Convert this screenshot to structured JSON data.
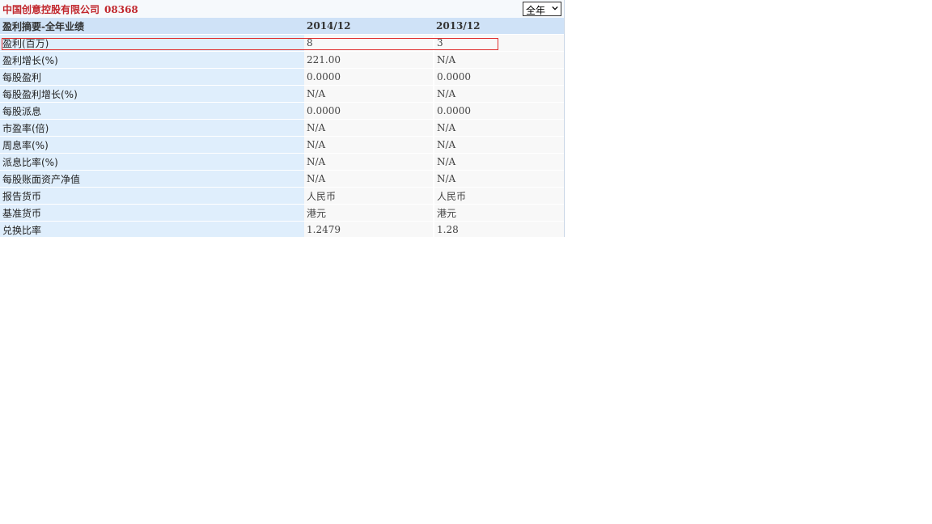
{
  "header": {
    "company_name": "中国创意控股有限公司",
    "stock_code": "08368",
    "period_select": {
      "value": "全年"
    }
  },
  "table": {
    "title": "盈利摘要-全年业绩",
    "columns": [
      "2014/12",
      "2013/12"
    ],
    "rows": [
      {
        "label": "盈利(百万)",
        "values": [
          "8",
          "3"
        ]
      },
      {
        "label": "盈利增长(%)",
        "values": [
          "221.00",
          "N/A"
        ]
      },
      {
        "label": "每股盈利",
        "values": [
          "0.0000",
          "0.0000"
        ]
      },
      {
        "label": "每股盈利增长(%)",
        "values": [
          "N/A",
          "N/A"
        ]
      },
      {
        "label": "每股派息",
        "values": [
          "0.0000",
          "0.0000"
        ]
      },
      {
        "label": "市盈率(倍)",
        "values": [
          "N/A",
          "N/A"
        ]
      },
      {
        "label": "周息率(%)",
        "values": [
          "N/A",
          "N/A"
        ]
      },
      {
        "label": "派息比率(%)",
        "values": [
          "N/A",
          "N/A"
        ]
      },
      {
        "label": "每股账面资产净值",
        "values": [
          "N/A",
          "N/A"
        ]
      },
      {
        "label": "报告货币",
        "values": [
          "人民币",
          "人民币"
        ]
      },
      {
        "label": "基准货币",
        "values": [
          "港元",
          "港元"
        ]
      },
      {
        "label": "兑换比率",
        "values": [
          "1.2479",
          "1.28"
        ]
      }
    ]
  },
  "colors": {
    "company": "#c1272d",
    "header_bg": "#cfe2f7",
    "label_bg": "#dfeefc",
    "highlight_border": "#e03030"
  }
}
